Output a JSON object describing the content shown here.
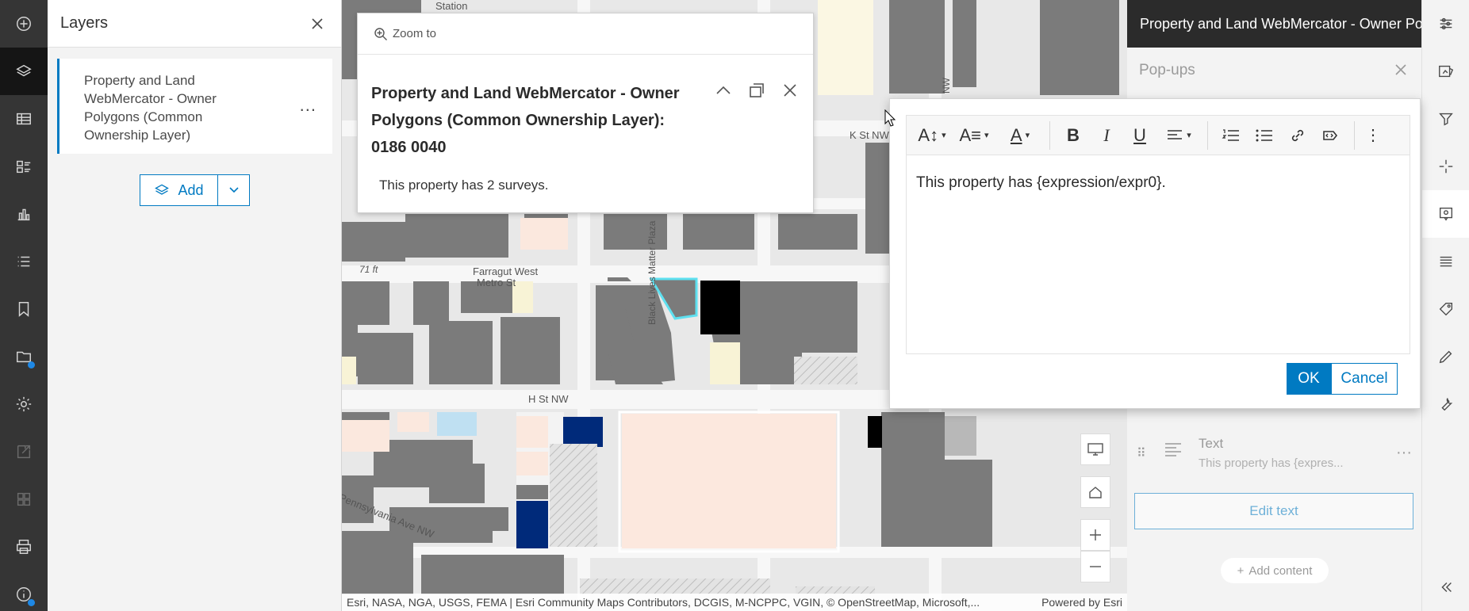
{
  "layers_panel": {
    "title": "Layers",
    "layer_name": "Property and Land WebMercator - Owner Polygons (Common Ownership Layer)",
    "more": "...",
    "add_label": "Add"
  },
  "map": {
    "labels": {
      "station": "Station",
      "k_st": "K St NW",
      "farragut": "Farragut West",
      "metro": "Metro St",
      "elev": "71 ft",
      "h_st": "H St NW",
      "black_lives": "Black Lives Matter Plaza",
      "pennsylvania": "Pennsylvania Ave NW",
      "nw": "NW"
    },
    "attribution": "Esri, NASA, NGA, USGS, FEMA | Esri Community Maps Contributors, DCGIS, M-NCPPC, VGIN, © OpenStreetMap, Microsoft,...",
    "powered_by": "Powered by Esri"
  },
  "popup": {
    "zoom_to": "Zoom to",
    "title": "Property and Land WebMercator - Owner Polygons (Common Ownership Layer): 0186 0040",
    "body": "This property has 2 surveys."
  },
  "side_panel": {
    "header": "Property and Land WebMercator - Owner Polygons (Common Ownership Layer)",
    "popups_title": "Pop-ups",
    "text_label": "Text",
    "text_preview": "This property has {expres...",
    "edit_text": "Edit text",
    "add_content": "Add content"
  },
  "editor": {
    "content": "This property has {expression/expr0}.",
    "ok": "OK",
    "cancel": "Cancel"
  },
  "colors": {
    "accent": "#007ac2",
    "rail": "#353535",
    "selected_outline": "#5ee0f0",
    "navy_parcel": "#002a7a"
  }
}
